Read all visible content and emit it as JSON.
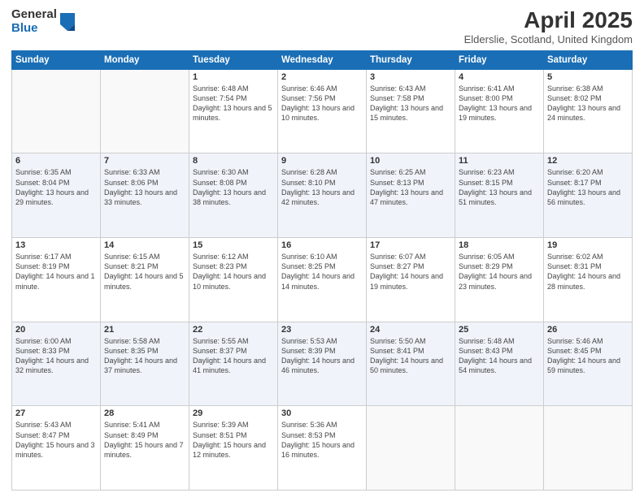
{
  "logo": {
    "general": "General",
    "blue": "Blue"
  },
  "title": "April 2025",
  "subtitle": "Elderslie, Scotland, United Kingdom",
  "days_of_week": [
    "Sunday",
    "Monday",
    "Tuesday",
    "Wednesday",
    "Thursday",
    "Friday",
    "Saturday"
  ],
  "weeks": [
    [
      {
        "day": "",
        "info": ""
      },
      {
        "day": "",
        "info": ""
      },
      {
        "day": "1",
        "info": "Sunrise: 6:48 AM\nSunset: 7:54 PM\nDaylight: 13 hours and 5 minutes."
      },
      {
        "day": "2",
        "info": "Sunrise: 6:46 AM\nSunset: 7:56 PM\nDaylight: 13 hours and 10 minutes."
      },
      {
        "day": "3",
        "info": "Sunrise: 6:43 AM\nSunset: 7:58 PM\nDaylight: 13 hours and 15 minutes."
      },
      {
        "day": "4",
        "info": "Sunrise: 6:41 AM\nSunset: 8:00 PM\nDaylight: 13 hours and 19 minutes."
      },
      {
        "day": "5",
        "info": "Sunrise: 6:38 AM\nSunset: 8:02 PM\nDaylight: 13 hours and 24 minutes."
      }
    ],
    [
      {
        "day": "6",
        "info": "Sunrise: 6:35 AM\nSunset: 8:04 PM\nDaylight: 13 hours and 29 minutes."
      },
      {
        "day": "7",
        "info": "Sunrise: 6:33 AM\nSunset: 8:06 PM\nDaylight: 13 hours and 33 minutes."
      },
      {
        "day": "8",
        "info": "Sunrise: 6:30 AM\nSunset: 8:08 PM\nDaylight: 13 hours and 38 minutes."
      },
      {
        "day": "9",
        "info": "Sunrise: 6:28 AM\nSunset: 8:10 PM\nDaylight: 13 hours and 42 minutes."
      },
      {
        "day": "10",
        "info": "Sunrise: 6:25 AM\nSunset: 8:13 PM\nDaylight: 13 hours and 47 minutes."
      },
      {
        "day": "11",
        "info": "Sunrise: 6:23 AM\nSunset: 8:15 PM\nDaylight: 13 hours and 51 minutes."
      },
      {
        "day": "12",
        "info": "Sunrise: 6:20 AM\nSunset: 8:17 PM\nDaylight: 13 hours and 56 minutes."
      }
    ],
    [
      {
        "day": "13",
        "info": "Sunrise: 6:17 AM\nSunset: 8:19 PM\nDaylight: 14 hours and 1 minute."
      },
      {
        "day": "14",
        "info": "Sunrise: 6:15 AM\nSunset: 8:21 PM\nDaylight: 14 hours and 5 minutes."
      },
      {
        "day": "15",
        "info": "Sunrise: 6:12 AM\nSunset: 8:23 PM\nDaylight: 14 hours and 10 minutes."
      },
      {
        "day": "16",
        "info": "Sunrise: 6:10 AM\nSunset: 8:25 PM\nDaylight: 14 hours and 14 minutes."
      },
      {
        "day": "17",
        "info": "Sunrise: 6:07 AM\nSunset: 8:27 PM\nDaylight: 14 hours and 19 minutes."
      },
      {
        "day": "18",
        "info": "Sunrise: 6:05 AM\nSunset: 8:29 PM\nDaylight: 14 hours and 23 minutes."
      },
      {
        "day": "19",
        "info": "Sunrise: 6:02 AM\nSunset: 8:31 PM\nDaylight: 14 hours and 28 minutes."
      }
    ],
    [
      {
        "day": "20",
        "info": "Sunrise: 6:00 AM\nSunset: 8:33 PM\nDaylight: 14 hours and 32 minutes."
      },
      {
        "day": "21",
        "info": "Sunrise: 5:58 AM\nSunset: 8:35 PM\nDaylight: 14 hours and 37 minutes."
      },
      {
        "day": "22",
        "info": "Sunrise: 5:55 AM\nSunset: 8:37 PM\nDaylight: 14 hours and 41 minutes."
      },
      {
        "day": "23",
        "info": "Sunrise: 5:53 AM\nSunset: 8:39 PM\nDaylight: 14 hours and 46 minutes."
      },
      {
        "day": "24",
        "info": "Sunrise: 5:50 AM\nSunset: 8:41 PM\nDaylight: 14 hours and 50 minutes."
      },
      {
        "day": "25",
        "info": "Sunrise: 5:48 AM\nSunset: 8:43 PM\nDaylight: 14 hours and 54 minutes."
      },
      {
        "day": "26",
        "info": "Sunrise: 5:46 AM\nSunset: 8:45 PM\nDaylight: 14 hours and 59 minutes."
      }
    ],
    [
      {
        "day": "27",
        "info": "Sunrise: 5:43 AM\nSunset: 8:47 PM\nDaylight: 15 hours and 3 minutes."
      },
      {
        "day": "28",
        "info": "Sunrise: 5:41 AM\nSunset: 8:49 PM\nDaylight: 15 hours and 7 minutes."
      },
      {
        "day": "29",
        "info": "Sunrise: 5:39 AM\nSunset: 8:51 PM\nDaylight: 15 hours and 12 minutes."
      },
      {
        "day": "30",
        "info": "Sunrise: 5:36 AM\nSunset: 8:53 PM\nDaylight: 15 hours and 16 minutes."
      },
      {
        "day": "",
        "info": ""
      },
      {
        "day": "",
        "info": ""
      },
      {
        "day": "",
        "info": ""
      }
    ]
  ]
}
